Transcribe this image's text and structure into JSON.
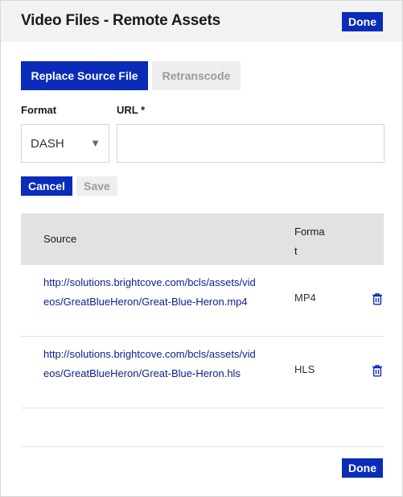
{
  "dialog": {
    "title": "Video Files - Remote Assets",
    "done_label": "Done"
  },
  "actions": {
    "replace_label": "Replace Source File",
    "retranscode_label": "Retranscode"
  },
  "form": {
    "format_label": "Format",
    "format_selected": "DASH",
    "url_label": "URL *",
    "url_value": "",
    "cancel_label": "Cancel",
    "save_label": "Save"
  },
  "table": {
    "columns": [
      "Source",
      "Format"
    ],
    "rows": [
      {
        "source": "http://solutions.brightcove.com/bcls/assets/videos/GreatBlueHeron/Great-Blue-Heron.mp4",
        "format": "MP4"
      },
      {
        "source": "http://solutions.brightcove.com/bcls/assets/videos/GreatBlueHeron/Great-Blue-Heron.hls",
        "format": "HLS"
      }
    ]
  },
  "footer": {
    "done_label": "Done"
  },
  "colors": {
    "primary": "#0a2cb8",
    "link": "#0a1f8c",
    "header_bg": "#f2f2f2",
    "table_header_bg": "#e2e2e2"
  },
  "icons": {
    "select_arrow": "chevron-down-icon",
    "delete": "trash-icon"
  }
}
